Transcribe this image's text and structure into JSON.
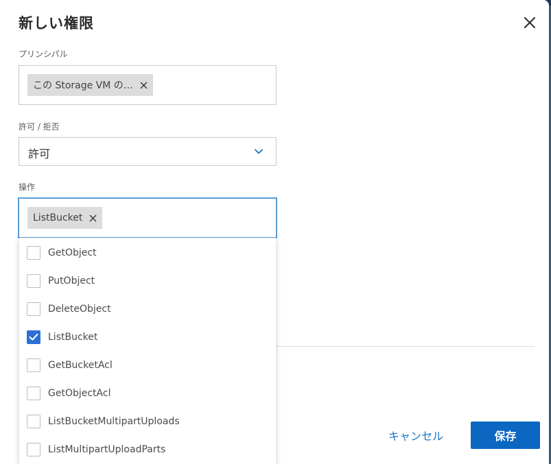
{
  "dialog": {
    "title": "新しい権限"
  },
  "principal": {
    "label": "プリンシパル",
    "chip": "この Storage VM の…"
  },
  "permission": {
    "label": "許可 / 拒否",
    "value": "許可"
  },
  "actions": {
    "label": "操作",
    "chip": "ListBucket",
    "options": [
      {
        "label": "GetObject",
        "checked": false
      },
      {
        "label": "PutObject",
        "checked": false
      },
      {
        "label": "DeleteObject",
        "checked": false
      },
      {
        "label": "ListBucket",
        "checked": true
      },
      {
        "label": "GetBucketAcl",
        "checked": false
      },
      {
        "label": "GetObjectAcl",
        "checked": false
      },
      {
        "label": "ListBucketMultipartUploads",
        "checked": false
      },
      {
        "label": "ListMultipartUploadParts",
        "checked": false
      }
    ]
  },
  "footer": {
    "cancel_label": "キャンセル",
    "save_label": "保存"
  },
  "colors": {
    "accent": "#0b67c2",
    "checkbox_checked": "#2c6fd6",
    "focus_border": "#5b9bd5"
  }
}
